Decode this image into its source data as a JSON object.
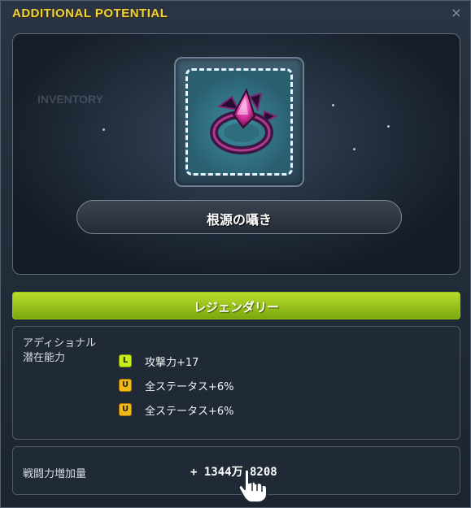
{
  "window": {
    "title": "ADDITIONAL POTENTIAL",
    "close_glyph": "×"
  },
  "background": {
    "ghost_label": "INVENTORY"
  },
  "item": {
    "name": "根源の囁き",
    "icon": "dark-ring-icon"
  },
  "grade": {
    "label": "レジェンダリー",
    "color": "#9cc21c"
  },
  "potential": {
    "heading_line1": "アディショナル",
    "heading_line2": "潜在能力",
    "lines": [
      {
        "badge": "L",
        "text": "攻撃力+17",
        "badge_color": "#c6ee1c"
      },
      {
        "badge": "U",
        "text": "全ステータス+6%",
        "badge_color": "#f3b91a"
      },
      {
        "badge": "U",
        "text": "全ステータス+6%",
        "badge_color": "#f3b91a"
      }
    ]
  },
  "combat_power": {
    "label": "戦闘力増加量",
    "value": "+ 1344万 8208"
  },
  "colors": {
    "title": "#f0d23a",
    "accent_green": "#b8dd2a"
  }
}
